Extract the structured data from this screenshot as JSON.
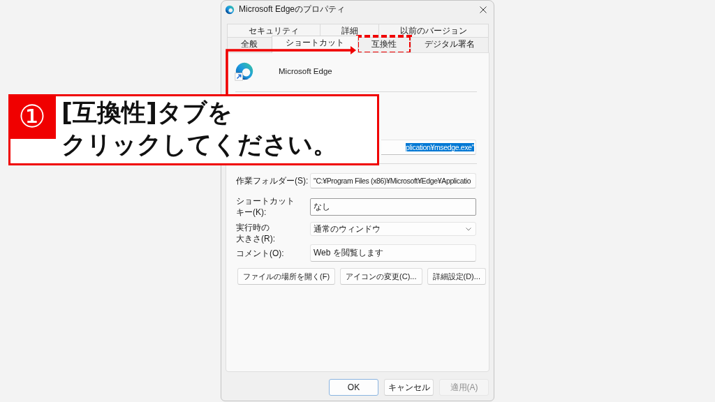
{
  "window": {
    "title": "Microsoft Edgeのプロパティ"
  },
  "tab_rows": [
    [
      {
        "label": "セキュリティ",
        "selected": false,
        "highlighted": false
      },
      {
        "label": "詳細",
        "selected": false,
        "highlighted": false
      },
      {
        "label": "以前のバージョン",
        "selected": false,
        "highlighted": false
      }
    ],
    [
      {
        "label": "全般",
        "selected": false,
        "highlighted": false
      },
      {
        "label": "ショートカット",
        "selected": true,
        "highlighted": false
      },
      {
        "label": "互換性",
        "selected": false,
        "highlighted": true
      },
      {
        "label": "デジタル署名",
        "selected": false,
        "highlighted": false
      }
    ]
  ],
  "shortcut_tab": {
    "name": "Microsoft Edge",
    "field_groups": [
      [
        {
          "kind": "text",
          "value": "plication¥msedge.exe\"",
          "selected": true
        }
      ],
      [
        {
          "kind": "text",
          "label_lines": [
            "作業フォルダー(S):"
          ],
          "value": "\"C:¥Program Files (x86)¥Microsoft¥Edge¥Applicatio",
          "selected": false
        },
        {
          "kind": "hotkey",
          "label_lines": [
            "ショートカット",
            "キー(K):"
          ],
          "value": "なし"
        },
        {
          "kind": "dropdown",
          "label_lines": [
            "実行時の",
            "大きさ(R):"
          ],
          "value": "通常のウィンドウ"
        },
        {
          "kind": "text",
          "label_lines": [
            "コメント(O):"
          ],
          "value": "Web を閲覧します",
          "selected": false
        }
      ]
    ],
    "buttons": [
      "ファイルの場所を開く(F)",
      "アイコンの変更(C)...",
      "詳細設定(D)..."
    ]
  },
  "dialog_buttons": [
    {
      "label": "OK",
      "default": true,
      "disabled": false
    },
    {
      "label": "キャンセル",
      "default": false,
      "disabled": false
    },
    {
      "label": "適用(A)",
      "default": false,
      "disabled": true
    }
  ],
  "callout": {
    "step": "①",
    "text_lines": [
      "[互換性]タブを",
      "クリックしてください。"
    ]
  }
}
